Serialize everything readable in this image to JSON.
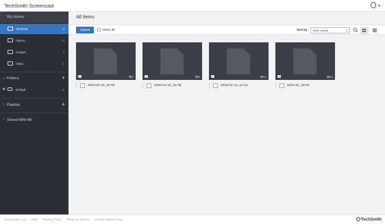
{
  "app": {
    "logo": "TechSmith Screencast"
  },
  "sidebar": {
    "title": "My Library",
    "items": [
      {
        "label": "All Items",
        "count": "4",
        "icon": "all-items-icon"
      },
      {
        "label": "Videos",
        "count": "0",
        "icon": "video-icon"
      },
      {
        "label": "Images",
        "count": "4",
        "icon": "image-icon"
      },
      {
        "label": "Other",
        "count": "1",
        "icon": "other-file-icon"
      }
    ],
    "folders_label": "Folders",
    "folders": [
      {
        "label": "Default",
        "count": "5"
      }
    ],
    "playlists_label": "Playlists",
    "shared_label": "Shared With Me"
  },
  "main": {
    "title": "All Items",
    "upload_label": "Upload",
    "select_all_label": "Select all",
    "sort_by_label": "Sort by",
    "sort_value": "Most viewed"
  },
  "cards": [
    {
      "name": "2019-02-10_20-02",
      "views": "0"
    },
    {
      "name": "2020-01-15_22-38",
      "views": "3"
    },
    {
      "name": "2019-02-14_21-12",
      "views": "16"
    },
    {
      "name": "2019-10_28-04",
      "views": "62"
    }
  ],
  "footer": {
    "links": [
      "Screencast.com",
      "Help",
      "Privacy Policy",
      "Terms of Service",
      "Cookie Notice Policy"
    ],
    "brand": "TechSmith"
  },
  "colors": {
    "accent": "#3575c5",
    "sidebar_bg": "#2b2f35",
    "thumb_bg": "#3b3f45",
    "star": "#f2c94c"
  }
}
